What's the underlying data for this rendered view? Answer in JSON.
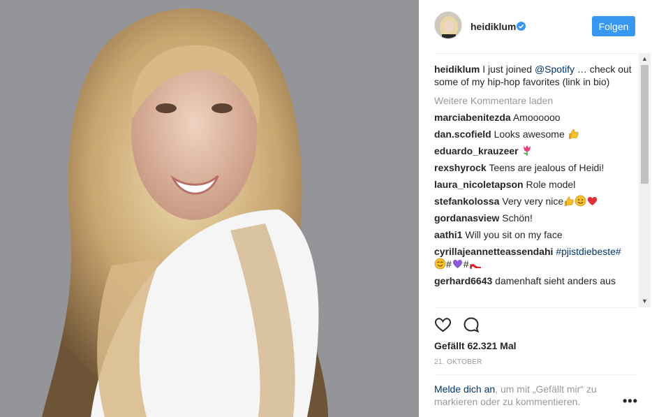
{
  "post": {
    "username": "heidiklum",
    "follow_label": "Folgen",
    "caption_user": "heidiklum",
    "caption_pre": "I just joined ",
    "caption_mention": "@Spotify",
    "caption_post": " … check out some of my hip-hop favorites (link in bio)",
    "load_more": "Weitere Kommentare laden",
    "likes": "Gefällt 62.321 Mal",
    "date": "21. OKTOBER",
    "login_link": "Melde dich an",
    "login_text": ", um mit „Gefällt mir“ zu markieren oder zu kommentieren.",
    "more_label": "•••"
  },
  "comments": [
    {
      "user": "marciabenitezda",
      "text": "Amoooooo"
    },
    {
      "user": "dan.scofield",
      "text": "Looks awesome",
      "emoji": "thumbs-up"
    },
    {
      "user": "eduardo_krauzeer",
      "text": "",
      "emoji": "tulip"
    },
    {
      "user": "rexshyrock",
      "text": "Teens are jealous of Heidi!"
    },
    {
      "user": "laura_nicoletapson",
      "text": "Role model"
    },
    {
      "user": "stefankolossa",
      "text": "Very very nice",
      "emoji": "thumbs-smile-heart"
    },
    {
      "user": "gordanasview",
      "text": "Schön!"
    },
    {
      "user": "aathi1",
      "text": "Will you sit on my face"
    },
    {
      "user": "cyrillajeannetteassendahi",
      "text": "#pjistdiebeste#",
      "emoji": "smile-heart-shoe",
      "emoji_text": "#",
      "emoji_text2": "#"
    },
    {
      "user": "gerhard6643",
      "text": "damenhaft sieht anders aus"
    }
  ],
  "colors": {
    "accent": "#3897f0",
    "link": "#003569",
    "muted": "#999999"
  },
  "icons": {
    "verified": "verified-badge-icon",
    "like": "heart-outline-icon",
    "comment": "speech-bubble-icon",
    "more": "ellipsis-icon"
  }
}
